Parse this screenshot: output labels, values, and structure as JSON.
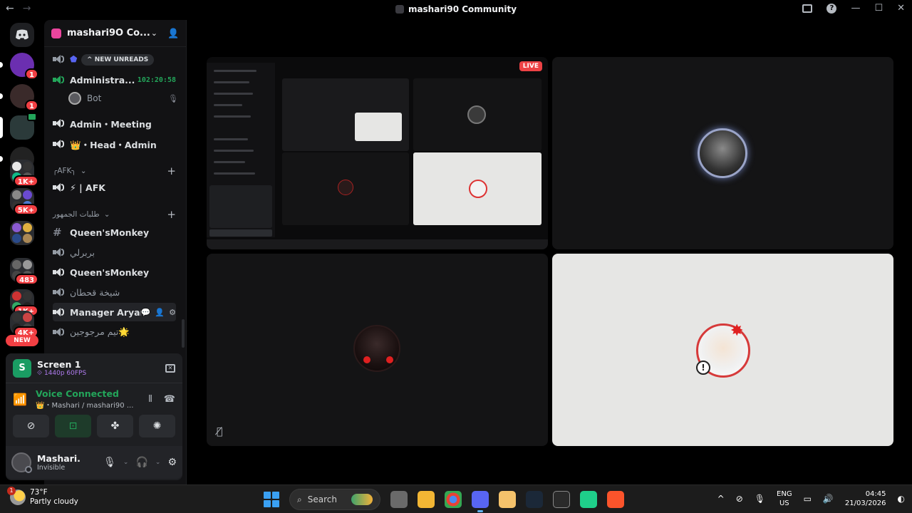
{
  "titlebar": {
    "title": "mashari90 Community",
    "back_icon": "arrow-left-icon",
    "forward_icon": "arrow-right-icon"
  },
  "rail": {
    "badges": [
      "1",
      "1",
      "1K+",
      "5K+",
      "483",
      "1K+",
      "4K+"
    ],
    "new_label": "NEW"
  },
  "server": {
    "name": "mashari9O Co...",
    "new_unreads": "NEW UNREADS",
    "partial_channel": "ins"
  },
  "channels": [
    {
      "label": "Administra...",
      "timer": "102:20:58",
      "type": "voice",
      "bold": true
    },
    {
      "label": "Admin・Meeting",
      "type": "voice",
      "bold": true
    },
    {
      "label": "👑・Head・Admin",
      "type": "voice",
      "bold": true
    },
    {
      "label": "⚡ | AFK",
      "type": "voice",
      "bold": true
    },
    {
      "label": "Queen'sMonkey",
      "type": "text",
      "bold": true
    },
    {
      "label": "بربرلي",
      "type": "voice",
      "bold": false
    },
    {
      "label": "Queen'sMonkey",
      "type": "voice",
      "bold": true
    },
    {
      "label": "شيخة قحطان",
      "type": "voice",
      "bold": false
    },
    {
      "label": "Manager Aryam",
      "type": "voice",
      "bold": true,
      "selected": true
    },
    {
      "label": "تيم مرجوجين🌟",
      "type": "voice",
      "bold": false
    }
  ],
  "vc_user": {
    "name": "Bot"
  },
  "categories": {
    "afk": "╭AFK╮",
    "requests": "طلبات الجمهور"
  },
  "stream": {
    "title": "Screen 1",
    "quality": "1440p 60FPS",
    "icon_letter": "S"
  },
  "voice": {
    "status": "Voice Connected",
    "channel": "👑・Mashari / mashari90 ..."
  },
  "user_panel": {
    "name": "Mashari.",
    "status": "Invisible"
  },
  "stage": {
    "live_label": "LIVE"
  },
  "taskbar": {
    "temp": "73°F",
    "weather": "Partly cloudy",
    "weather_badge": "1",
    "search": "Search",
    "lang1": "ENG",
    "lang2": "US",
    "time": "04:45",
    "date": "21/03/2026"
  },
  "colors": {
    "accent_green": "#23a55a",
    "badge_red": "#f23f43",
    "brand": "#5865f2"
  }
}
